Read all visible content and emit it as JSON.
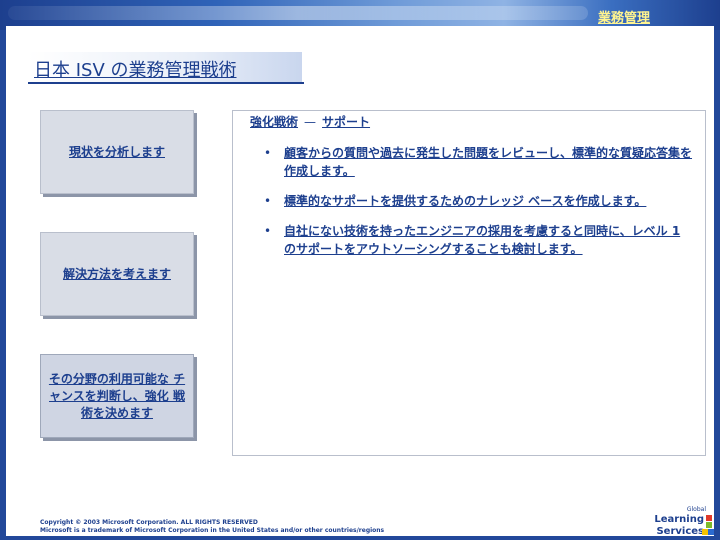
{
  "header": {
    "section_label": "業務管理"
  },
  "title": "日本 ISV の業務管理戦術",
  "steps": [
    {
      "label": "現状を分析します"
    },
    {
      "label": "解決方法を考えます"
    },
    {
      "label": "その分野の利用可能な チャンスを判断し、強化 戦術を決めます"
    }
  ],
  "panel": {
    "heading_left": "強化戦術",
    "heading_dash": "—",
    "heading_right": "サポート",
    "bullets": [
      "顧客からの質問や過去に発生した問題をレビューし、標準的な質疑応答集を作成します。",
      "標準的なサポートを提供するためのナレッジ ベースを作成します。",
      "自社にない技術を持ったエンジニアの採用を考慮すると同時に、レベル 1 のサポートをアウトソーシングすることも検討します。"
    ],
    "bullet_glyph": "•"
  },
  "footer": {
    "line1": "Copyright © 2003 Microsoft Corporation. ALL RIGHTS RESERVED",
    "line2": "Microsoft is a trademark of Microsoft Corporation in the United States and/or other countries/regions"
  },
  "logo": {
    "line1": "Global",
    "line2": "Learning",
    "line3": "Services"
  },
  "colors": {
    "accent": "#1d3f8e",
    "header_text": "#fff48f"
  }
}
